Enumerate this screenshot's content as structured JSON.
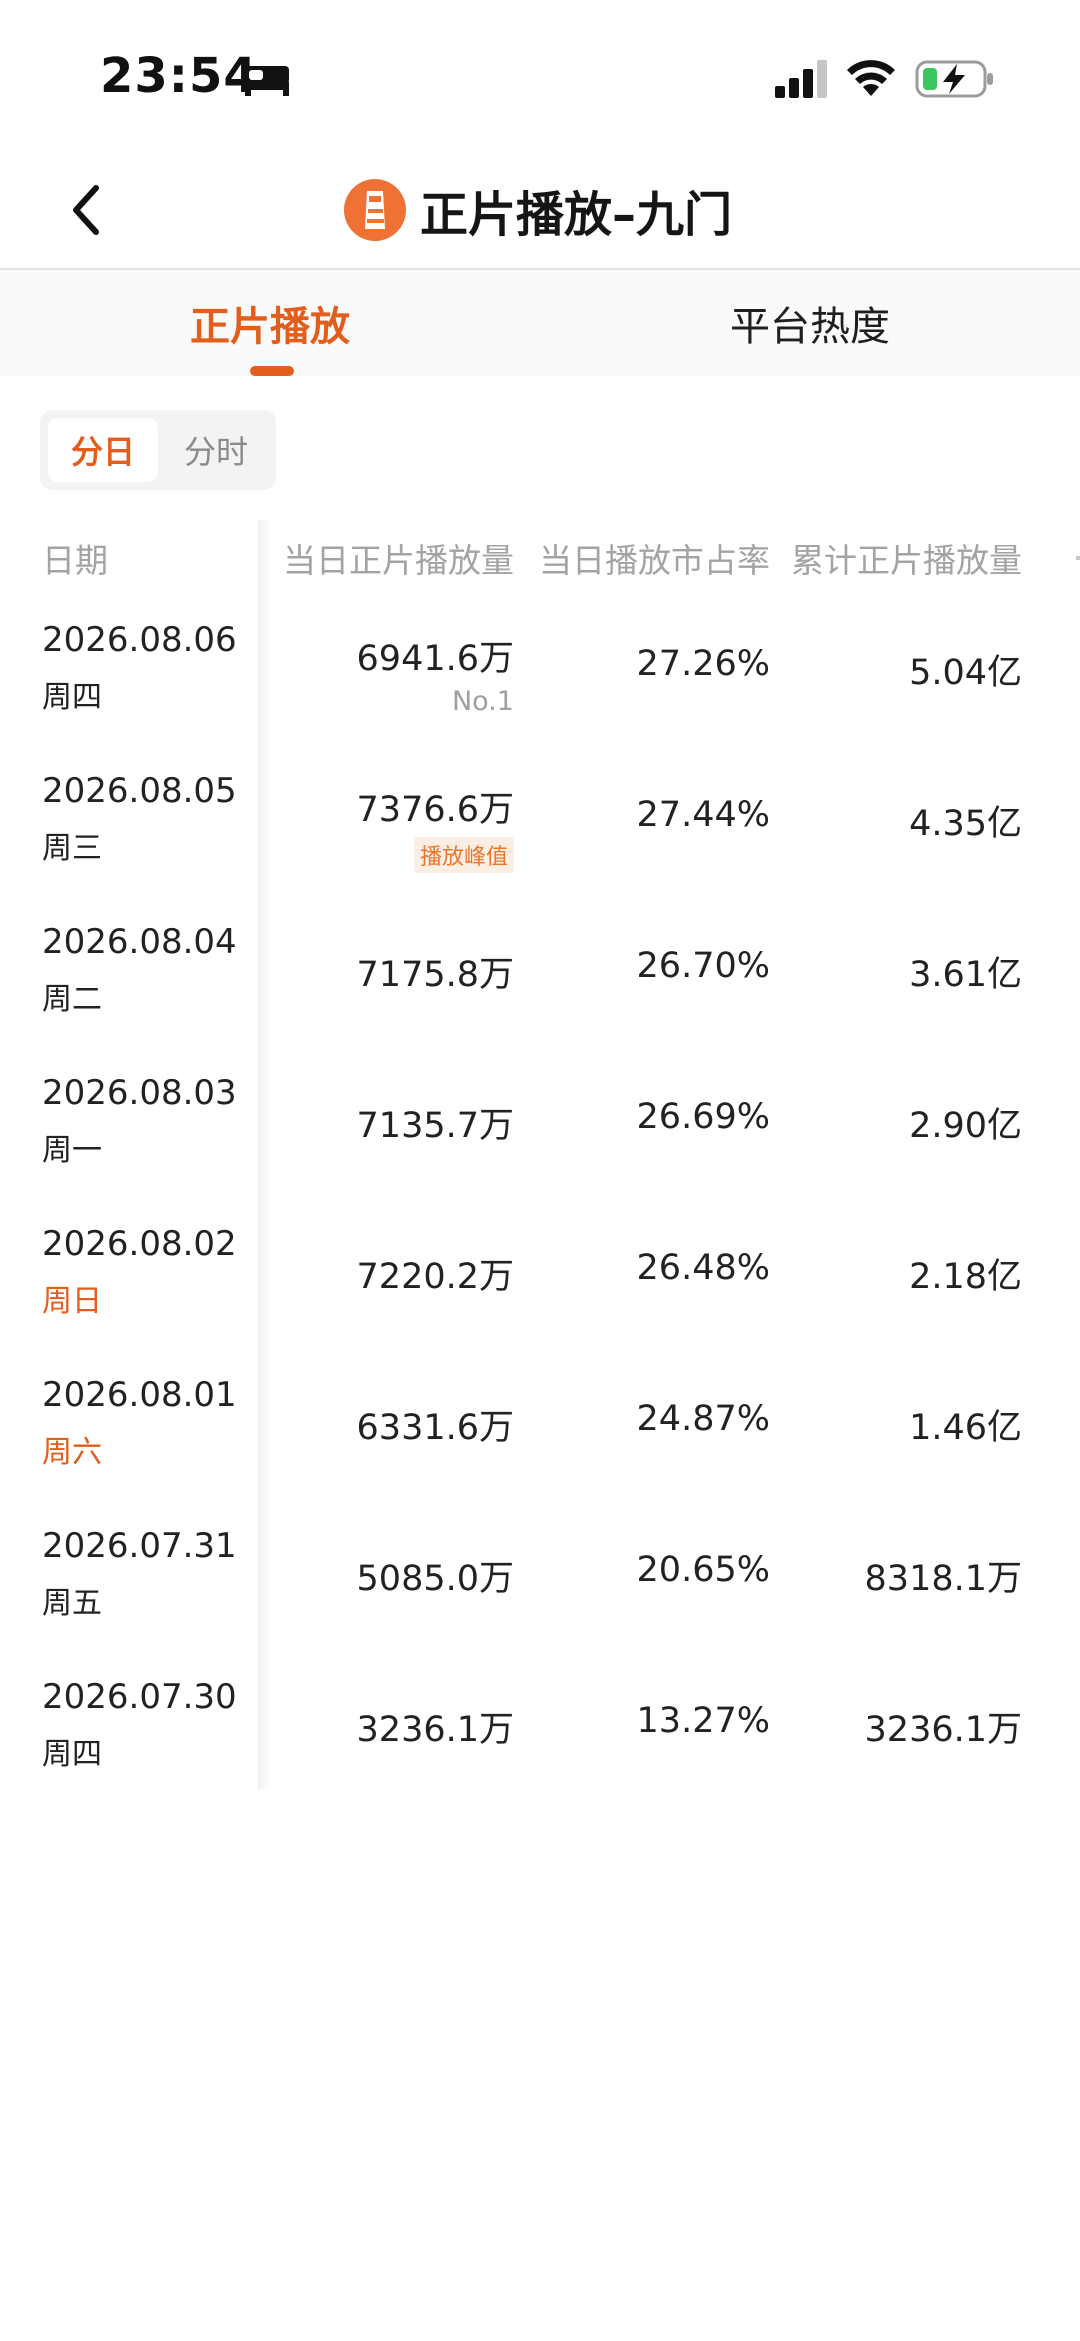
{
  "status_bar": {
    "time": "23:54"
  },
  "nav": {
    "title": "正片播放–九门"
  },
  "tabs": [
    {
      "label": "正片播放"
    },
    {
      "label": "平台热度"
    }
  ],
  "segmented": {
    "options": [
      "分日",
      "分时"
    ],
    "selected": "分日"
  },
  "table": {
    "headers": [
      "日期",
      "当日正片播放量",
      "当日播放市占率",
      "累计正片播放量"
    ],
    "rows": [
      {
        "date": "2026.08.06",
        "weekday": "周四",
        "daily": "6941.6万",
        "note": "No.1",
        "share": "27.26%",
        "cumulative": "5.04亿"
      },
      {
        "date": "2026.08.05",
        "weekday": "周三",
        "daily": "7376.6万",
        "badge": "播放峰值",
        "share": "27.44%",
        "cumulative": "4.35亿"
      },
      {
        "date": "2026.08.04",
        "weekday": "周二",
        "daily": "7175.8万",
        "share": "26.70%",
        "cumulative": "3.61亿"
      },
      {
        "date": "2026.08.03",
        "weekday": "周一",
        "daily": "7135.7万",
        "share": "26.69%",
        "cumulative": "2.90亿"
      },
      {
        "date": "2026.08.02",
        "weekday": "周日",
        "daily": "7220.2万",
        "share": "26.48%",
        "cumulative": "2.18亿"
      },
      {
        "date": "2026.08.01",
        "weekday": "周六",
        "daily": "6331.6万",
        "share": "24.87%",
        "cumulative": "1.46亿"
      },
      {
        "date": "2026.07.31",
        "weekday": "周五",
        "daily": "5085.0万",
        "share": "20.65%",
        "cumulative": "8318.1万"
      },
      {
        "date": "2026.07.30",
        "weekday": "周四",
        "daily": "3236.1万",
        "share": "13.27%",
        "cumulative": "3236.1万"
      }
    ]
  },
  "colors": {
    "accent": "#e35d1b",
    "text": "#1f1f1f",
    "muted": "#a3a3a3"
  }
}
